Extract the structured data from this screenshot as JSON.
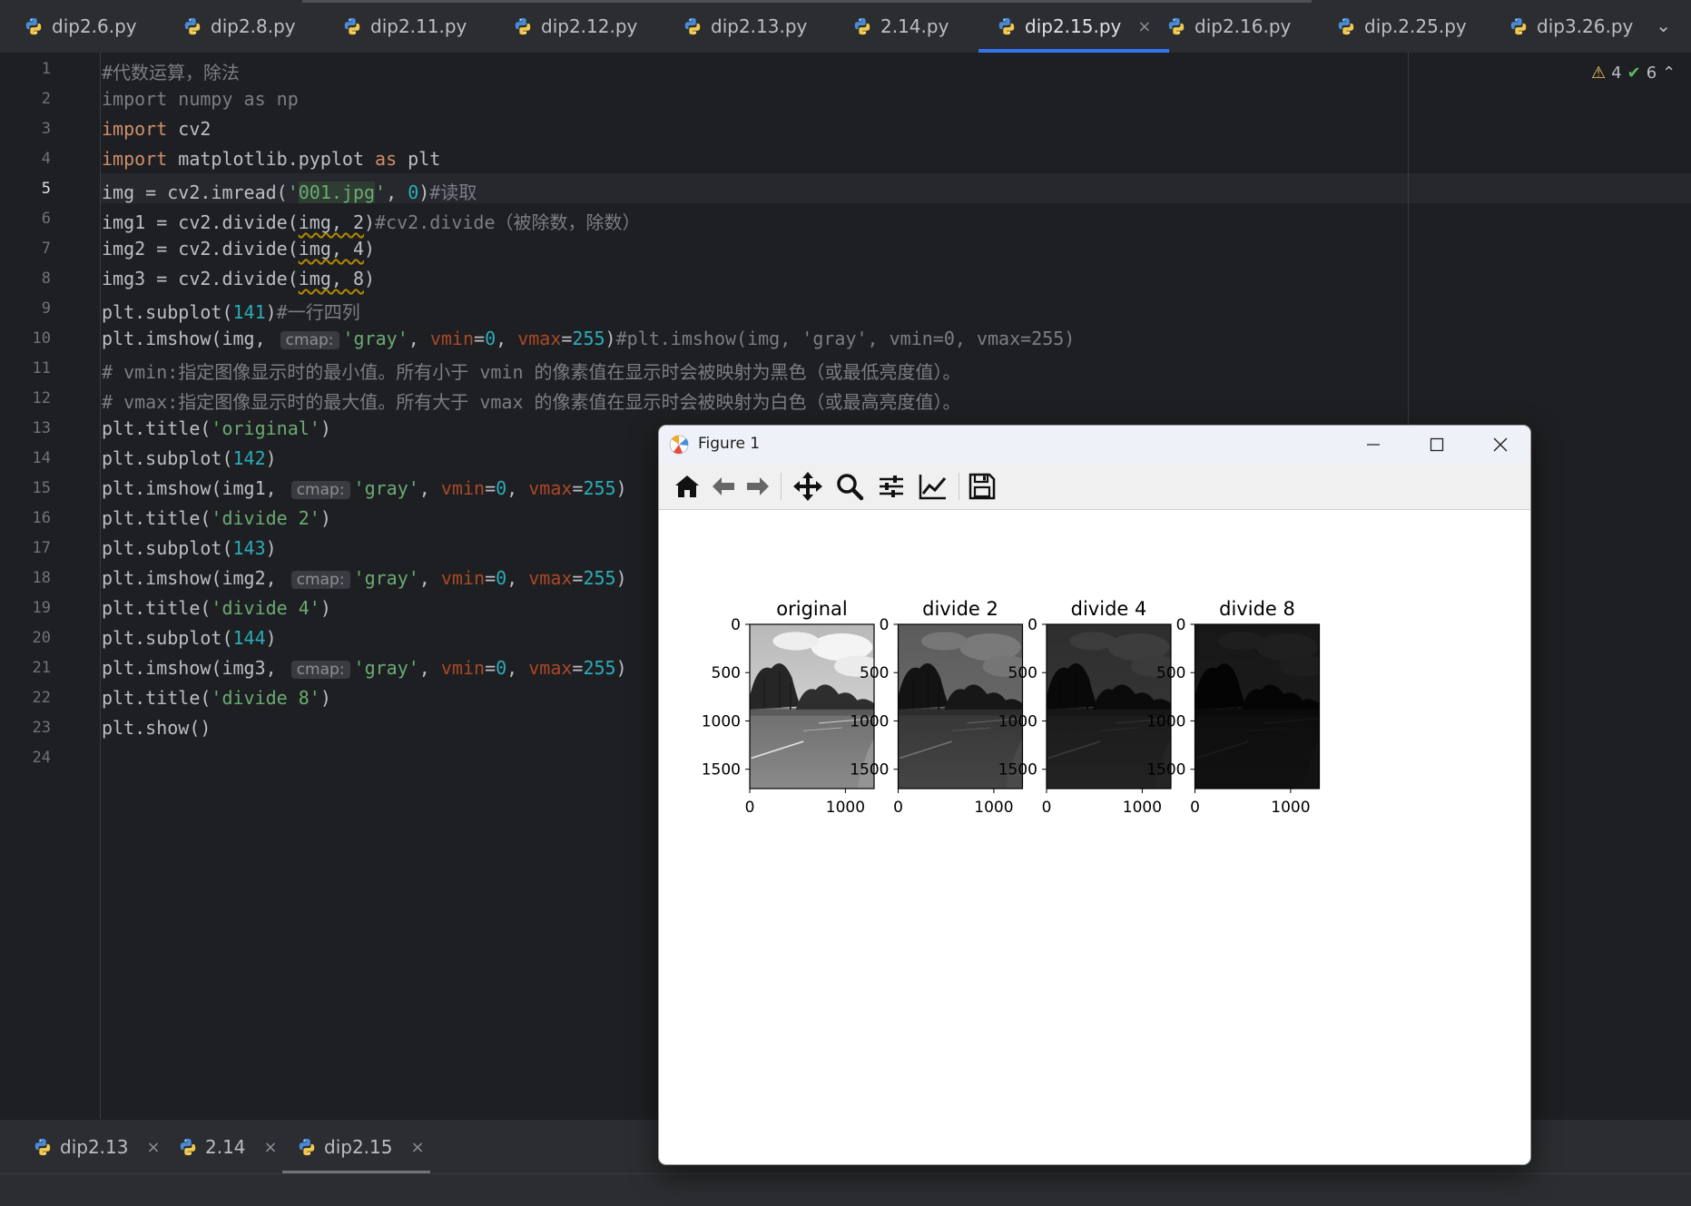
{
  "editor_tabs": [
    {
      "label": "dip2.6.py"
    },
    {
      "label": "dip2.8.py"
    },
    {
      "label": "dip2.11.py"
    },
    {
      "label": "dip2.12.py"
    },
    {
      "label": "dip2.13.py"
    },
    {
      "label": "2.14.py"
    },
    {
      "label": "dip2.15.py",
      "active": true,
      "close": "×"
    },
    {
      "label": "dip2.16.py"
    },
    {
      "label": "dip.2.25.py"
    },
    {
      "label": "dip3.26.py"
    }
  ],
  "tab_overflow": "⌄",
  "inspections": {
    "warnings": "4",
    "ok": "6"
  },
  "current_line": "5",
  "code": {
    "l1": "#代数运算，除法",
    "l2": "import numpy as np",
    "l3_kw": "import",
    "l3_rest": " cv2",
    "l4_kw": "import",
    "l4_mod": " matplotlib.pyplot ",
    "l4_as": "as",
    "l4_rest": " plt",
    "l5_a": "img = cv2.imread(",
    "l5_q1": "'",
    "l5_file": "001.jpg",
    "l5_q2": "'",
    "l5_b": ", ",
    "l5_n": "0",
    "l5_c": ")",
    "l5_cm": "#读取",
    "l6_a": "img1 = cv2.divide(",
    "l6_arg": "img, 2",
    "l6_c": ")",
    "l6_cm": "#cv2.divide（被除数，除数）",
    "l7_a": "img2 = cv2.divide(",
    "l7_arg": "img, 4",
    "l7_c": ")",
    "l8_a": "img3 = cv2.divide(",
    "l8_arg": "img, 8",
    "l8_c": ")",
    "l9_a": "plt.subplot(",
    "l9_n": "141",
    "l9_c": ")",
    "l9_cm": "#一行四列",
    "l10_a": "plt.imshow(img, ",
    "hint": "cmap:",
    "l10_s": "'gray'",
    "l10_b": ", ",
    "p_vmin": "vmin",
    "eq": "=",
    "n0": "0",
    "p_vmax": "vmax",
    "n255": "255",
    "l10_c": ")",
    "l10_cm": "#plt.imshow(img, 'gray', vmin=0, vmax=255)",
    "l11": "# vmin:指定图像显示时的最小值。所有小于 vmin 的像素值在显示时会被映射为黑色（或最低亮度值）。",
    "l12": "# vmax:指定图像显示时的最大值。所有大于 vmax 的像素值在显示时会被映射为白色（或最高亮度值）。",
    "l13_a": "plt.title(",
    "l13_s": "'original'",
    "l13_c": ")",
    "l14_a": "plt.subplot(",
    "l14_n": "142",
    "l14_c": ")",
    "l15_a": "plt.imshow(img1, ",
    "l16_a": "plt.title(",
    "l16_s": "'divide 2'",
    "l16_c": ")",
    "l17_a": "plt.subplot(",
    "l17_n": "143",
    "l17_c": ")",
    "l18_a": "plt.imshow(img2, ",
    "l19_a": "plt.title(",
    "l19_s": "'divide 4'",
    "l19_c": ")",
    "l20_a": "plt.subplot(",
    "l20_n": "144",
    "l20_c": ")",
    "l21_a": "plt.imshow(img3, ",
    "l22_a": "plt.title(",
    "l22_s": "'divide 8'",
    "l22_c": ")",
    "l23": "plt.show()",
    "l24": ""
  },
  "bottom_tabs": [
    {
      "label": "dip2.13",
      "close": "×"
    },
    {
      "label": "2.14",
      "close": "×"
    },
    {
      "label": "dip2.15",
      "close": "×",
      "active": true
    }
  ],
  "figure_window": {
    "title": "Figure 1",
    "toolbar": [
      "home-icon",
      "back-icon",
      "forward-icon",
      "pan-icon",
      "zoom-icon",
      "configure-subplots-icon",
      "edit-axes-icon",
      "save-icon"
    ]
  },
  "chart_data": [
    {
      "type": "heatmap",
      "title": "original",
      "xlabel": "",
      "ylabel": "",
      "xlim": [
        0,
        1300
      ],
      "ylim": [
        1700,
        0
      ],
      "xticks": [
        0,
        1000
      ],
      "yticks": [
        0,
        500,
        1000,
        1500
      ],
      "brightness": 1.0
    },
    {
      "type": "heatmap",
      "title": "divide 2",
      "xlabel": "",
      "ylabel": "",
      "xlim": [
        0,
        1300
      ],
      "ylim": [
        1700,
        0
      ],
      "xticks": [
        0,
        1000
      ],
      "yticks": [
        0,
        500,
        1000,
        1500
      ],
      "brightness": 0.5
    },
    {
      "type": "heatmap",
      "title": "divide 4",
      "xlabel": "",
      "ylabel": "",
      "xlim": [
        0,
        1300
      ],
      "ylim": [
        1700,
        0
      ],
      "xticks": [
        0,
        1000
      ],
      "yticks": [
        0,
        500,
        1000,
        1500
      ],
      "brightness": 0.25
    },
    {
      "type": "heatmap",
      "title": "divide 8",
      "xlabel": "",
      "ylabel": "",
      "xlim": [
        0,
        1300
      ],
      "ylim": [
        1700,
        0
      ],
      "xticks": [
        0,
        1000
      ],
      "yticks": [
        0,
        500,
        1000,
        1500
      ],
      "brightness": 0.125
    }
  ]
}
